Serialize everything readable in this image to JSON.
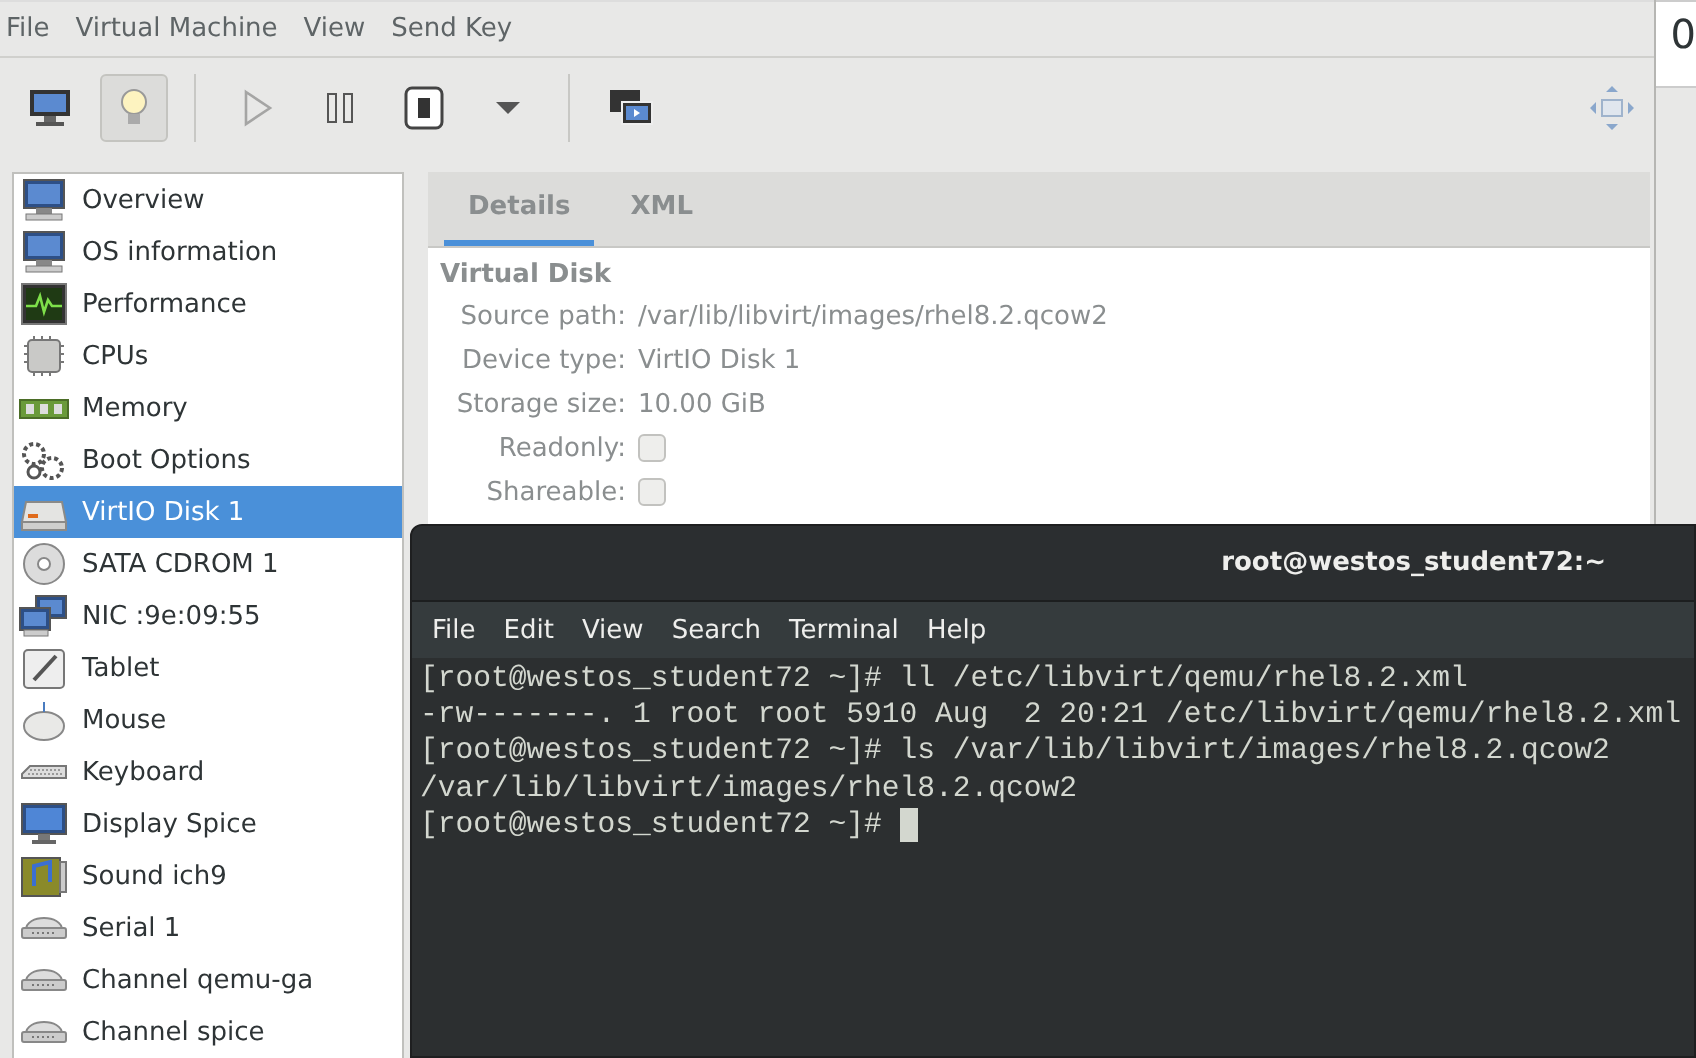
{
  "menu_bar": [
    "File",
    "Virtual Machine",
    "View",
    "Send Key"
  ],
  "toolbar": [
    {
      "kind": "monitor",
      "selected": false,
      "disabled": false
    },
    {
      "kind": "bulb",
      "selected": true,
      "disabled": false
    },
    {
      "kind": "separator"
    },
    {
      "kind": "play",
      "selected": false,
      "disabled": true
    },
    {
      "kind": "pause",
      "selected": false,
      "disabled": false
    },
    {
      "kind": "power",
      "selected": false,
      "disabled": false
    },
    {
      "kind": "caret",
      "selected": false,
      "disabled": false
    },
    {
      "kind": "separator"
    },
    {
      "kind": "screens",
      "selected": false,
      "disabled": false
    },
    {
      "kind": "fullscreen",
      "selected": false,
      "disabled": false
    }
  ],
  "sidebar": {
    "items": [
      {
        "label": "Overview",
        "selected": false
      },
      {
        "label": "OS information",
        "selected": false
      },
      {
        "label": "Performance",
        "selected": false
      },
      {
        "label": "CPUs",
        "selected": false
      },
      {
        "label": "Memory",
        "selected": false
      },
      {
        "label": "Boot Options",
        "selected": false
      },
      {
        "label": "VirtIO Disk 1",
        "selected": true
      },
      {
        "label": "SATA CDROM 1",
        "selected": false
      },
      {
        "label": "NIC :9e:09:55",
        "selected": false
      },
      {
        "label": "Tablet",
        "selected": false
      },
      {
        "label": "Mouse",
        "selected": false
      },
      {
        "label": "Keyboard",
        "selected": false
      },
      {
        "label": "Display Spice",
        "selected": false
      },
      {
        "label": "Sound ich9",
        "selected": false
      },
      {
        "label": "Serial 1",
        "selected": false
      },
      {
        "label": "Channel qemu-ga",
        "selected": false
      },
      {
        "label": "Channel spice",
        "selected": false
      }
    ]
  },
  "tabs": [
    {
      "label": "Details",
      "selected": true
    },
    {
      "label": "XML",
      "selected": false
    }
  ],
  "details": {
    "section_title": "Virtual Disk",
    "fields": [
      {
        "kind": "text",
        "label": "Source path:",
        "value": "/var/lib/libvirt/images/rhel8.2.qcow2"
      },
      {
        "kind": "text",
        "label": "Device type:",
        "value": "VirtIO Disk 1"
      },
      {
        "kind": "text",
        "label": "Storage size:",
        "value": "10.00 GiB"
      },
      {
        "kind": "checkbox",
        "label": "Readonly:",
        "checked": false
      },
      {
        "kind": "checkbox",
        "label": "Shareable:",
        "checked": false
      }
    ]
  },
  "background_window": {
    "text": "0"
  },
  "terminal": {
    "title": "root@westos_student72:~",
    "menu": [
      "File",
      "Edit",
      "View",
      "Search",
      "Terminal",
      "Help"
    ],
    "lines": [
      "[root@westos_student72 ~]# ll /etc/libvirt/qemu/rhel8.2.xml",
      "-rw-------. 1 root root 5910 Aug  2 20:21 /etc/libvirt/qemu/rhel8.2.xml",
      "[root@westos_student72 ~]# ls /var/lib/libvirt/images/rhel8.2.qcow2",
      "/var/lib/libvirt/images/rhel8.2.qcow2",
      "[root@westos_student72 ~]# "
    ],
    "cursor": true
  }
}
